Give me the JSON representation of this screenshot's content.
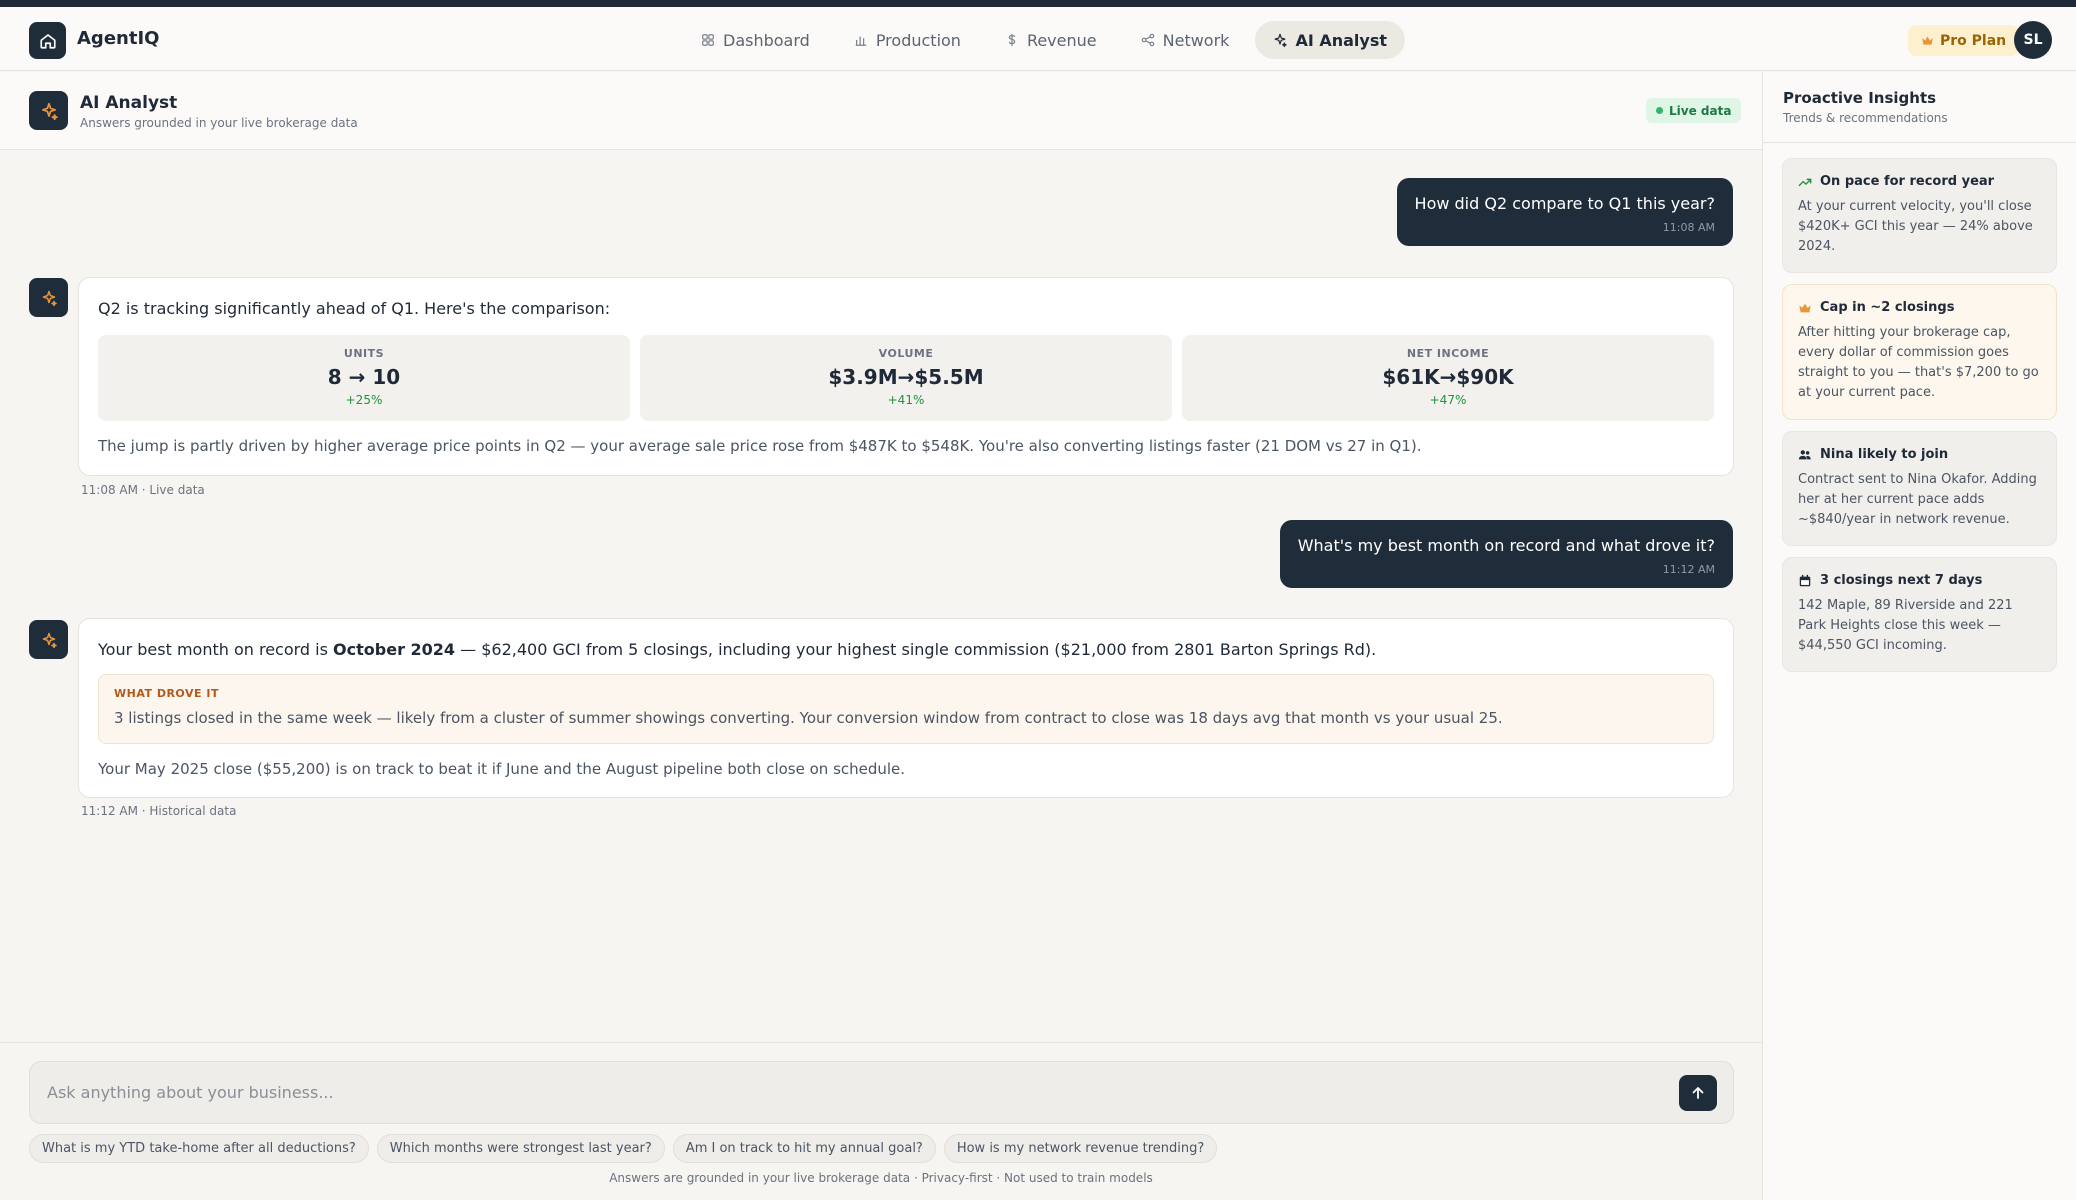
{
  "app": {
    "brand": "AgentIQ",
    "accent": "#1f2d3b",
    "orange": "#e9963a"
  },
  "nav": [
    {
      "label": "Dashboard",
      "icon": "grid-icon"
    },
    {
      "label": "Production",
      "icon": "bar-chart-icon"
    },
    {
      "label": "Revenue",
      "icon": "dollar-icon"
    },
    {
      "label": "Network",
      "icon": "network-icon"
    },
    {
      "label": "AI Analyst",
      "icon": "sparkle-icon",
      "active": true
    }
  ],
  "header": {
    "plan": "Pro Plan",
    "avatar_initials": "SL"
  },
  "chat": {
    "title": "AI Analyst",
    "subtitle": "Answers grounded in your live brokerage data",
    "status": "Live data"
  },
  "messages": {
    "q1": {
      "text": "How did Q2 compare to Q1 this year?",
      "time": "11:08 AM"
    },
    "a1": {
      "intro": "Q2 is tracking significantly ahead of Q1. Here's the comparison:",
      "stats": [
        {
          "label": "UNITS",
          "value": "8 → 10",
          "delta": "+25%"
        },
        {
          "label": "VOLUME",
          "value": "$3.9M→$5.5M",
          "delta": "+41%"
        },
        {
          "label": "NET INCOME",
          "value": "$61K→$90K",
          "delta": "+47%"
        }
      ],
      "note": "The jump is partly driven by higher average price points in Q2 — your average sale price rose from $487K to $548K. You're also converting listings faster (21 DOM vs 27 in Q1).",
      "meta": "11:08 AM · Live data"
    },
    "q2": {
      "text": "What's my best month on record and what drove it?",
      "time": "11:12 AM"
    },
    "a2": {
      "text_pre": "Your best month on record is ",
      "text_bold": "October 2024",
      "text_post": " — $62,400 GCI from 5 closings, including your highest single commission ($21,000 from 2801 Barton Springs Rd).",
      "drove_label": "WHAT DROVE IT",
      "drove_text": "3 listings closed in the same week — likely from a cluster of summer showings converting. Your conversion window from contract to close was 18 days avg that month vs your usual 25.",
      "note": "Your May 2025 close ($55,200) is on track to beat it if June and the August pipeline both close on schedule.",
      "meta": "11:12 AM · Historical data"
    }
  },
  "composer": {
    "placeholder": "Ask anything about your business...",
    "suggestions": [
      "What is my YTD take-home after all deductions?",
      "Which months were strongest last year?",
      "Am I on track to hit my annual goal?",
      "How is my network revenue trending?"
    ],
    "footnote": "Answers are grounded in your live brokerage data · Privacy-first · Not used to train models"
  },
  "sidebar": {
    "title": "Proactive Insights",
    "subtitle": "Trends & recommendations",
    "insights": [
      {
        "title": "On pace for record year",
        "icon": "trending-up-icon",
        "body": "At your current velocity, you'll close $420K+ GCI this year — 24% above 2024."
      },
      {
        "title": "Cap in ~2 closings",
        "icon": "crown-icon",
        "body": "After hitting your brokerage cap, every dollar of commission goes straight to you — that's $7,200 to go at your current pace."
      },
      {
        "title": "Nina likely to join",
        "icon": "users-icon",
        "body": "Contract sent to Nina Okafor. Adding her at her current pace adds ~$840/year in network revenue."
      },
      {
        "title": "3 closings next 7 days",
        "icon": "calendar-icon",
        "body": "142 Maple, 89 Riverside and 221 Park Heights close this week — $44,550 GCI incoming."
      }
    ]
  }
}
